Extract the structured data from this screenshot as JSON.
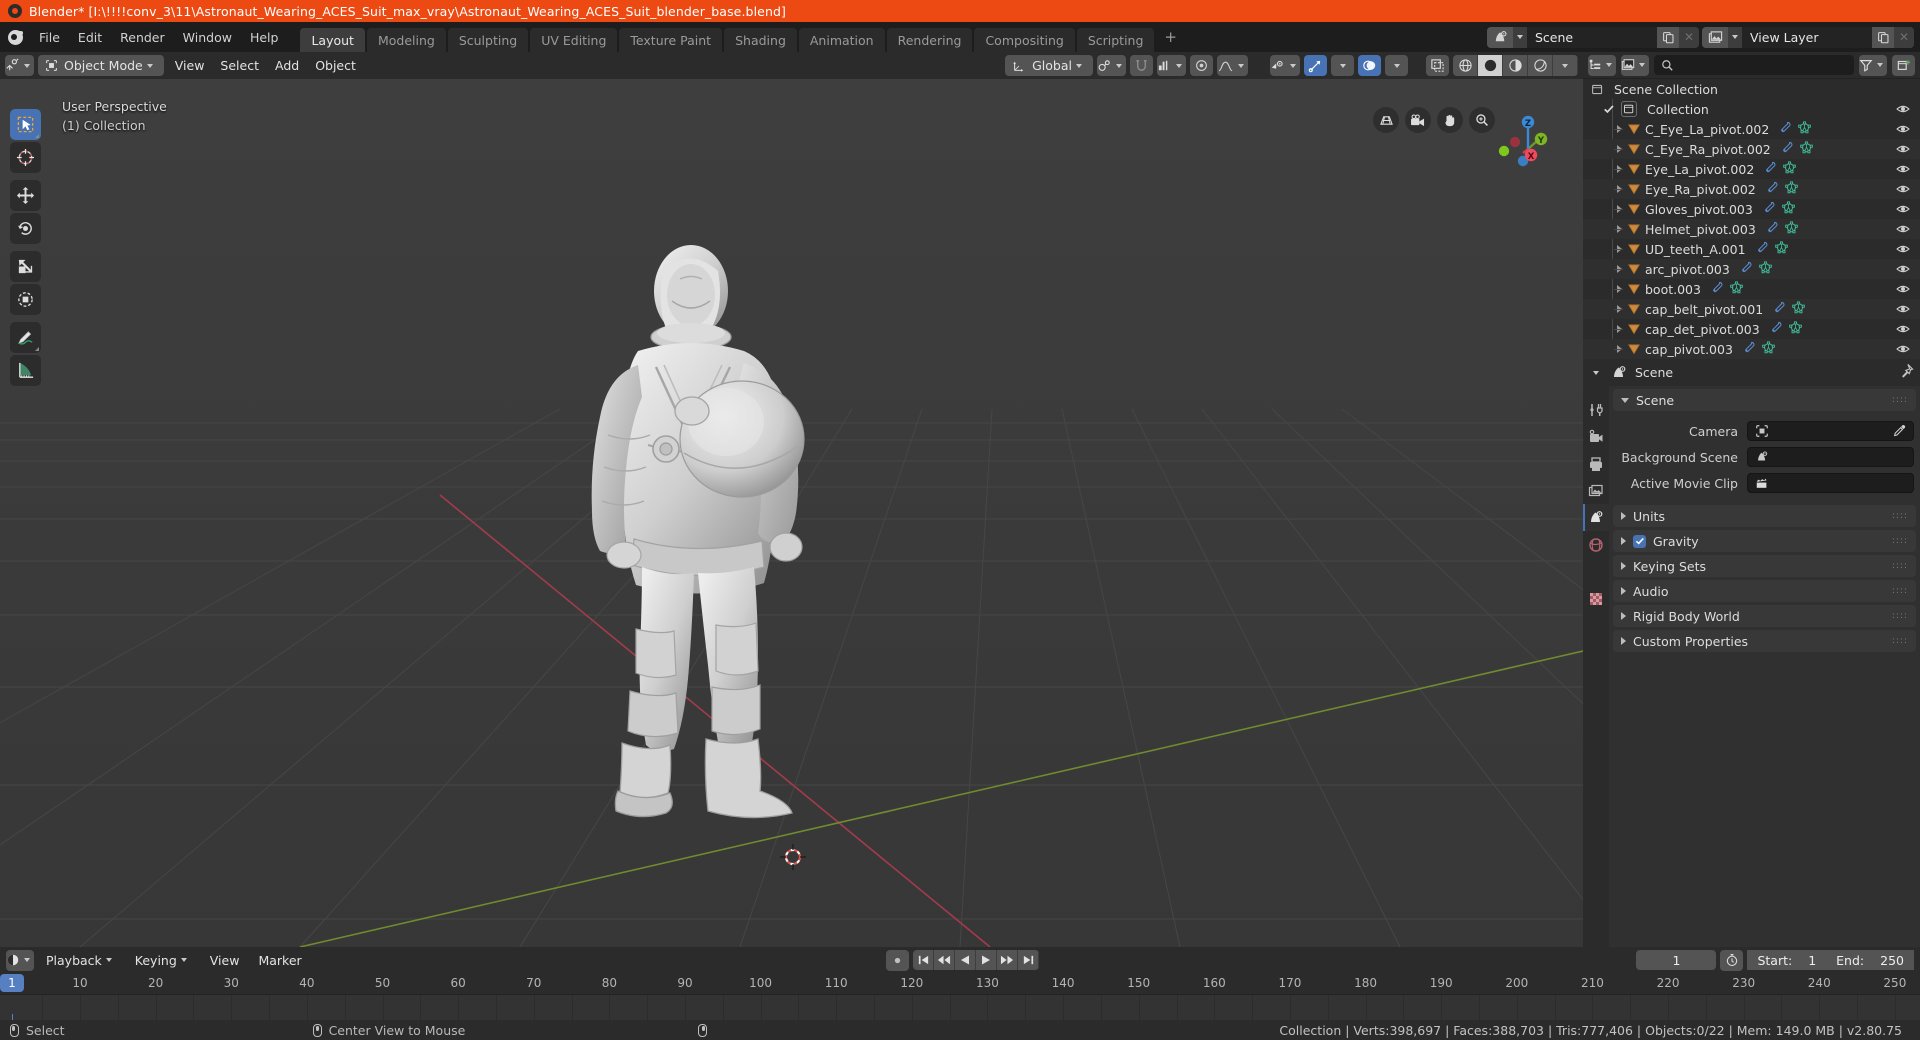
{
  "titlebar": {
    "text": "Blender* [I:\\!!!!conv_3\\11\\Astronaut_Wearing_ACES_Suit_max_vray\\Astronaut_Wearing_ACES_Suit_blender_base.blend]",
    "bg": "#ec4a12"
  },
  "topbar": {
    "menus": [
      "File",
      "Edit",
      "Render",
      "Window",
      "Help"
    ],
    "workspaces": [
      "Layout",
      "Modeling",
      "Sculpting",
      "UV Editing",
      "Texture Paint",
      "Shading",
      "Animation",
      "Rendering",
      "Compositing",
      "Scripting"
    ],
    "active_workspace": "Layout",
    "add_workspace": "+",
    "scene_name": "Scene",
    "view_layer_name": "View Layer"
  },
  "viewport": {
    "mode": "Object Mode",
    "menus": [
      "View",
      "Select",
      "Add",
      "Object"
    ],
    "transform_orientation": "Global",
    "perspective_label": "User Perspective",
    "collection_label": "(1) Collection",
    "gizmo_axes": [
      "X",
      "Y",
      "Z"
    ],
    "tools": [
      "select-box-tool",
      "cursor-tool",
      "move-tool",
      "rotate-tool",
      "scale-tool",
      "transform-tool",
      "annotate-tool",
      "measure-tool"
    ],
    "nav_buttons": [
      "toggle-camera-perspective",
      "camera-view",
      "move-view",
      "zoom-view"
    ]
  },
  "outliner": {
    "display_mode": "View Layer",
    "search_placeholder": "",
    "root": "Scene Collection",
    "collection": "Collection",
    "items": [
      {
        "name": "C_Eye_La_pivot.002",
        "icons": [
          "modifier",
          "mesh"
        ]
      },
      {
        "name": "C_Eye_Ra_pivot.002",
        "icons": [
          "modifier",
          "mesh"
        ]
      },
      {
        "name": "Eye_La_pivot.002",
        "icons": [
          "modifier",
          "mesh"
        ]
      },
      {
        "name": "Eye_Ra_pivot.002",
        "icons": [
          "modifier",
          "mesh"
        ]
      },
      {
        "name": "Gloves_pivot.003",
        "icons": [
          "modifier",
          "mesh"
        ]
      },
      {
        "name": "Helmet_pivot.003",
        "icons": [
          "modifier",
          "mesh"
        ]
      },
      {
        "name": "UD_teeth_A.001",
        "icons": [
          "modifier",
          "mesh"
        ]
      },
      {
        "name": "arc_pivot.003",
        "icons": [
          "modifier",
          "mesh"
        ]
      },
      {
        "name": "boot.003",
        "icons": [
          "modifier",
          "mesh"
        ]
      },
      {
        "name": "cap_belt_pivot.001",
        "icons": [
          "modifier",
          "mesh"
        ]
      },
      {
        "name": "cap_det_pivot.003",
        "icons": [
          "modifier",
          "mesh"
        ]
      },
      {
        "name": "cap_pivot.003",
        "icons": [
          "modifier",
          "mesh"
        ]
      }
    ]
  },
  "properties": {
    "breadcrumb": "Scene",
    "tabs": [
      "tool",
      "render",
      "output",
      "view-layer",
      "scene",
      "world",
      "object",
      "texture"
    ],
    "active_tab": "scene",
    "panels": [
      {
        "name": "Scene",
        "open": true
      },
      {
        "name": "Units",
        "open": false
      },
      {
        "name": "Gravity",
        "open": false,
        "checkbox": true
      },
      {
        "name": "Keying Sets",
        "open": false
      },
      {
        "name": "Audio",
        "open": false
      },
      {
        "name": "Rigid Body World",
        "open": false
      },
      {
        "name": "Custom Properties",
        "open": false
      }
    ],
    "scene_fields": [
      {
        "label": "Camera",
        "value": "",
        "icon": "camera-object-icon",
        "eyedropper": true
      },
      {
        "label": "Background Scene",
        "value": "",
        "icon": "scene-icon",
        "eyedropper": false
      },
      {
        "label": "Active Movie Clip",
        "value": "",
        "icon": "clip-icon",
        "eyedropper": false
      }
    ]
  },
  "timeline": {
    "menus": [
      "Playback",
      "Keying",
      "View",
      "Marker"
    ],
    "current_frame": "1",
    "start_label": "Start:",
    "start_value": "1",
    "end_label": "End:",
    "end_value": "250",
    "ticks": [
      1,
      10,
      20,
      30,
      40,
      50,
      60,
      70,
      80,
      90,
      100,
      110,
      120,
      130,
      140,
      150,
      160,
      170,
      180,
      190,
      200,
      210,
      220,
      230,
      240,
      250
    ],
    "playhead_frame": 1,
    "transport": [
      "jump-to-start",
      "jump-prev-keyframe",
      "play-reverse",
      "play",
      "jump-next-keyframe",
      "jump-to-end"
    ]
  },
  "statusbar": {
    "hints": [
      {
        "mouse": "left",
        "label": "Select"
      },
      {
        "mouse": "middle",
        "label": "Center View to Mouse"
      },
      {
        "mouse": "right",
        "label": ""
      }
    ],
    "stats": "Collection | Verts:398,697 | Faces:388,703 | Tris:777,406 | Objects:0/22 | Mem: 149.0 MB | v2.80.75"
  },
  "colors": {
    "accent": "#4772b3",
    "title_bg": "#ec4a12",
    "viewport_bg": "#3b3b3b",
    "panel_bg": "#303030",
    "header_bg": "#2b2b2b"
  }
}
